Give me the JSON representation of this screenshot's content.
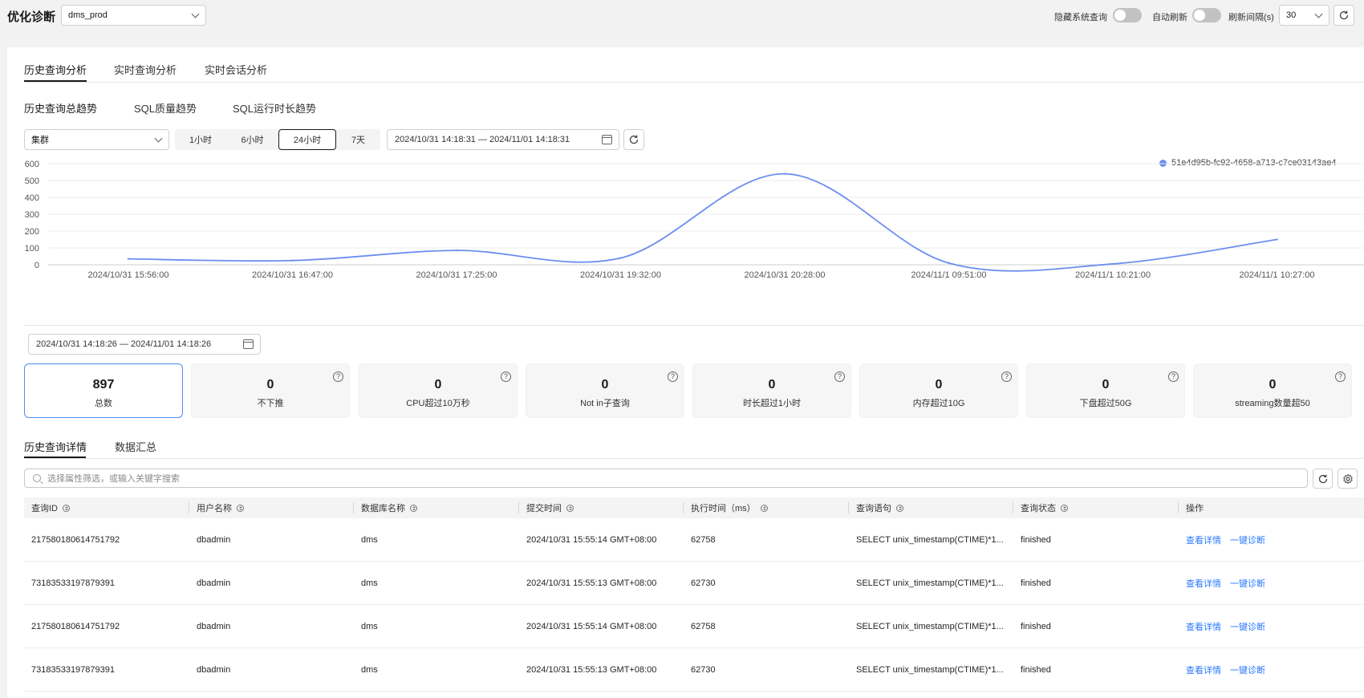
{
  "header": {
    "title": "优化诊断",
    "db_select": "dms_prod",
    "hide_system_query_label": "隐藏系统查询",
    "auto_refresh_label": "自动刷新",
    "refresh_interval_label": "刷新间隔(s)",
    "refresh_interval_value": "30"
  },
  "main_tabs": [
    "历史查询分析",
    "实时查询分析",
    "实时会话分析"
  ],
  "sub_tabs": [
    "历史查询总趋势",
    "SQL质量趋势",
    "SQL运行时长趋势"
  ],
  "filter": {
    "scope_select": "集群",
    "time_ranges": [
      "1小时",
      "6小时",
      "24小时",
      "7天"
    ],
    "active_range_index": 2,
    "date_range": "2024/10/31 14:18:31 — 2024/11/01 14:18:31"
  },
  "chart_data": {
    "type": "line",
    "x": [
      "2024/10/31 15:56:00",
      "2024/10/31 16:47:00",
      "2024/10/31 17:25:00",
      "2024/10/31 19:32:00",
      "2024/10/31 20:28:00",
      "2024/11/1 09:51:00",
      "2024/11/1 10:21:00",
      "2024/11/1 10:27:00"
    ],
    "series": [
      {
        "name": "51e4d95b-fc92-4658-a713-c7ce03143ae4",
        "values": [
          35,
          25,
          85,
          40,
          540,
          10,
          5,
          150
        ],
        "color": "#6c8ef0"
      }
    ],
    "yticks": [
      0,
      100,
      200,
      300,
      400,
      500,
      600
    ],
    "ylim": [
      0,
      600
    ],
    "grid": true,
    "legend": "top-right"
  },
  "stats": {
    "date_range": "2024/10/31 14:18:26 — 2024/11/01 14:18:26",
    "cards": [
      {
        "value": "897",
        "label": "总数"
      },
      {
        "value": "0",
        "label": "不下推"
      },
      {
        "value": "0",
        "label": "CPU超过10万秒"
      },
      {
        "value": "0",
        "label": "Not in子查询"
      },
      {
        "value": "0",
        "label": "时长超过1小时"
      },
      {
        "value": "0",
        "label": "内存超过10G"
      },
      {
        "value": "0",
        "label": "下盘超过50G"
      },
      {
        "value": "0",
        "label": "streaming数量超50"
      }
    ],
    "help_glyph": "?"
  },
  "detail_tabs": [
    "历史查询详情",
    "数据汇总"
  ],
  "search": {
    "placeholder": "选择属性筛选，或输入关键字搜索"
  },
  "table": {
    "columns": [
      "查询ID",
      "用户名称",
      "数据库名称",
      "提交时间",
      "执行时间（ms）",
      "查询语句",
      "查询状态",
      "操作"
    ],
    "rows": [
      [
        "217580180614751792",
        "dbadmin",
        "dms",
        "2024/10/31 15:55:14 GMT+08:00",
        "62758",
        "SELECT unix_timestamp(CTIME)*1...",
        "finished"
      ],
      [
        "73183533197879391",
        "dbadmin",
        "dms",
        "2024/10/31 15:55:13 GMT+08:00",
        "62730",
        "SELECT unix_timestamp(CTIME)*1...",
        "finished"
      ],
      [
        "217580180614751792",
        "dbadmin",
        "dms",
        "2024/10/31 15:55:14 GMT+08:00",
        "62758",
        "SELECT unix_timestamp(CTIME)*1...",
        "finished"
      ],
      [
        "73183533197879391",
        "dbadmin",
        "dms",
        "2024/10/31 15:55:13 GMT+08:00",
        "62730",
        "SELECT unix_timestamp(CTIME)*1...",
        "finished"
      ]
    ],
    "actions": [
      "查看详情",
      "一键诊断"
    ]
  }
}
